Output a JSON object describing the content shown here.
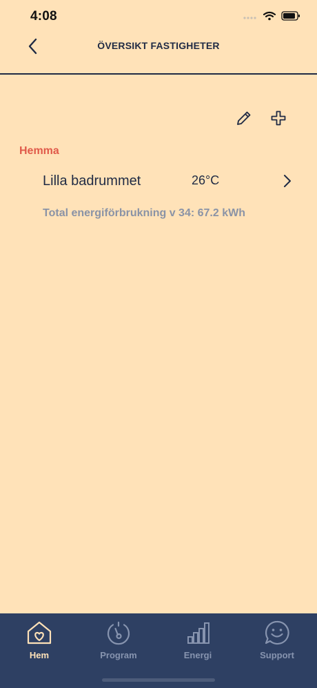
{
  "status_bar": {
    "time": "4:08"
  },
  "header": {
    "title": "ÖVERSIKT FASTIGHETER",
    "back_icon": "chevron-left-icon"
  },
  "toolbar": {
    "edit_icon": "pencil-icon",
    "add_icon": "plus-icon"
  },
  "property": {
    "name": "Hemma",
    "rooms": [
      {
        "name": "Lilla badrummet",
        "temperature": "26°C"
      }
    ],
    "energy_summary": "Total energiförbrukning v 34: 67.2 kWh"
  },
  "tabs": [
    {
      "label": "Hem",
      "icon": "home-heart-icon",
      "active": true
    },
    {
      "label": "Program",
      "icon": "dial-icon",
      "active": false
    },
    {
      "label": "Energi",
      "icon": "bar-chart-icon",
      "active": false
    },
    {
      "label": "Support",
      "icon": "smiley-chat-icon",
      "active": false
    }
  ],
  "colors": {
    "background": "#FFE2B8",
    "navy": "#1F2A44",
    "accent_red": "#E05A4A",
    "muted_text": "#8A93A6",
    "tab_bar": "#2E4063",
    "tab_active": "#FFE2B8",
    "tab_inactive": "#8794AF"
  }
}
